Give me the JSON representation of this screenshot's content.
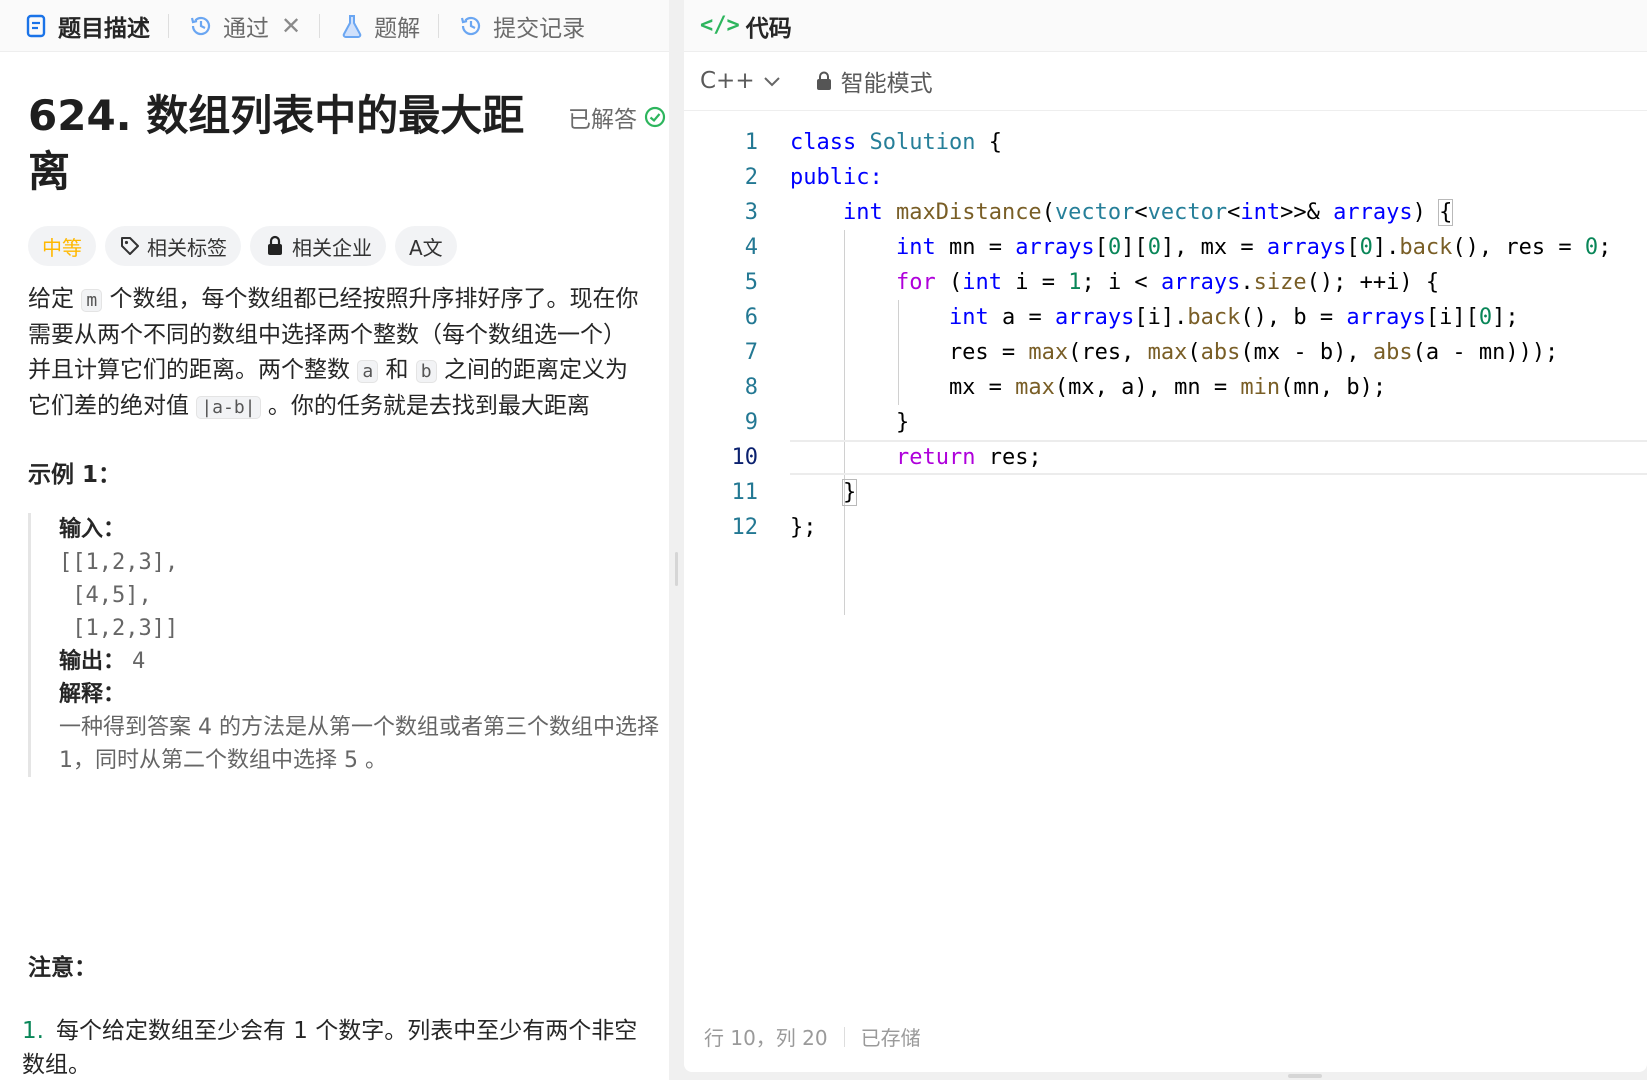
{
  "left_tabs": [
    {
      "label": "题目描述",
      "icon": "description-icon"
    },
    {
      "label": "通过",
      "icon": "history-icon"
    },
    {
      "label": "题解",
      "icon": "flask-icon"
    },
    {
      "label": "提交记录",
      "icon": "history-icon"
    }
  ],
  "problem": {
    "title": "624. 数组列表中的最大距离",
    "status": "已解答",
    "tags": {
      "difficulty": "中等",
      "related_tags": "相关标签",
      "related_companies": "相关企业",
      "font_toggle": "A文"
    },
    "desc": {
      "p1": "给定",
      "m": "m",
      "p2": "个数组，每个数组都已经按照升序排好序了。现在你需要从两个不同的数组中选择两个整数（每个数组选一个）并且计算它们的距离。两个整数",
      "a": "a",
      "he": "和",
      "b": "b",
      "p3": "之间的距离定义为它们差的绝对值",
      "absab": "|a-b|",
      "p4": "。你的任务就是去找到最大距离"
    },
    "example": {
      "title": "示例 1：",
      "input_label": "输入：",
      "input_lines": [
        "[[1,2,3],",
        " [4,5],",
        " [1,2,3]]"
      ],
      "output_label": "输出：",
      "output_value": "4",
      "explain_label": "解释：",
      "explain_text": "一种得到答案 4 的方法是从第一个数组或者第三个数组中选择 1，同时从第二个数组中选择 5 。"
    },
    "note_title": "注意：",
    "notes": [
      {
        "num": "1.",
        "text": "每个给定数组至少会有 1 个数字。列表中至少有两个非空数组。"
      }
    ]
  },
  "right": {
    "tab_label": "代码",
    "language": "C++",
    "mode": "智能模式",
    "code_lines": [
      "class Solution {",
      "public:",
      "    int maxDistance(vector<vector<int>>& arrays) {",
      "        int mn = arrays[0][0], mx = arrays[0].back(), res = 0;",
      "        for (int i = 1; i < arrays.size(); ++i) {",
      "            int a = arrays[i].back(), b = arrays[i][0];",
      "            res = max(res, max(abs(mx - b), abs(a - mn)));",
      "            mx = max(mx, a), mn = min(mn, b);",
      "        }",
      "        return res;",
      "    }",
      "};"
    ],
    "current_line": 10,
    "status_position": "行 10，列 20",
    "status_saved": "已存储"
  },
  "colors": {
    "accent_green": "#2db55d",
    "difficulty_yellow": "#ffb800",
    "keyword_blue": "#0000ff",
    "type_teal": "#267f99",
    "function_brown": "#795e26",
    "number_green": "#098658",
    "control_purple": "#af00db"
  }
}
